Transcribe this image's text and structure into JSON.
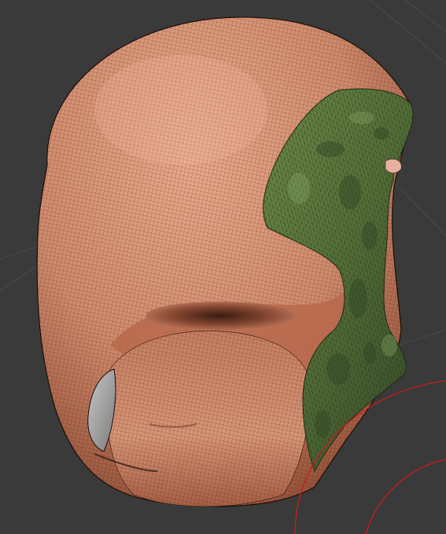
{
  "viewport": {
    "background_color": "#3a3a3a",
    "grid_color": "#4a4a4a",
    "mesh": {
      "surface_color": "#d08a6c",
      "surface_shadow_color": "#7a3f2a",
      "surface_highlight_color": "#e8a88a",
      "wire_color": "#3a2218",
      "selected_region_color": "#5c7a3e",
      "selected_region_dark_color": "#2f4424",
      "selected_region_highlight_color": "#8aa868",
      "selected_wire_color": "#1d2a14"
    },
    "gizmo": {
      "color": "#cc1b1b",
      "icon": "rotate-gizmo-icon"
    }
  }
}
